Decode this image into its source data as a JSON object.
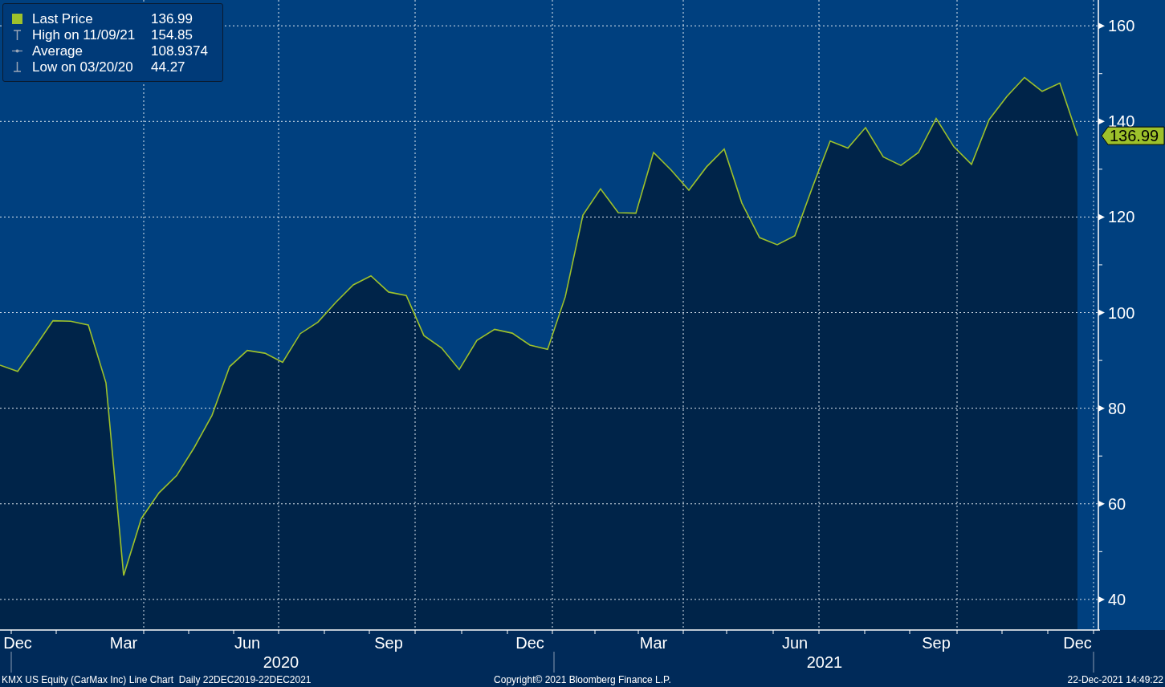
{
  "legend": [
    {
      "kind": "last",
      "value": "136.99"
    },
    {
      "kind": "high",
      "label": "High on 11/09/21",
      "value": "154.85"
    },
    {
      "kind": "average",
      "label": "Average",
      "value": "108.9374"
    },
    {
      "kind": "low",
      "label": "Low on 03/20/20",
      "value": "44.27"
    }
  ],
  "last_price_tag": "136.99",
  "chart_data": {
    "type": "line",
    "grid": true,
    "ylim": [
      33.6,
      165.4
    ],
    "yticks": [
      40,
      60,
      80,
      100,
      120,
      140,
      160
    ],
    "categories": [
      null,
      "Dec",
      null,
      null,
      null,
      null,
      null,
      "Mar",
      null,
      null,
      null,
      null,
      null,
      null,
      "Jun",
      null,
      null,
      null,
      null,
      null,
      null,
      null,
      "Sep",
      null,
      null,
      null,
      null,
      null,
      null,
      null,
      "Dec",
      null,
      null,
      null,
      null,
      null,
      null,
      "Mar",
      null,
      null,
      null,
      null,
      null,
      null,
      null,
      "Jun",
      null,
      null,
      null,
      null,
      null,
      null,
      null,
      "Sep",
      null,
      null,
      null,
      null,
      null,
      null,
      null,
      "Dec"
    ],
    "series": [
      {
        "name": "Last Price",
        "color": "#9dc12b",
        "values": [
          89,
          87.7,
          92.9,
          98.3,
          98.2,
          97.4,
          85.3,
          45,
          56.9,
          62.3,
          65.9,
          71.8,
          78.5,
          88.7,
          92.1,
          91.5,
          89.6,
          95.6,
          98,
          102.1,
          105.8,
          107.7,
          104.3,
          103.6,
          95.2,
          92.6,
          88.1,
          94.2,
          96.5,
          95.7,
          93.2,
          92.3,
          103.3,
          120.4,
          125.9,
          120.9,
          120.8,
          133.5,
          129.8,
          125.6,
          130.5,
          134.2,
          122.9,
          115.7,
          114.2,
          116.1,
          126.3,
          135.9,
          134.4,
          138.7,
          132.6,
          130.8,
          133.5,
          140.6,
          134.7,
          131,
          140.4,
          145.2,
          149.2,
          146.3,
          148,
          137
        ]
      }
    ]
  },
  "x_axis_years": [
    "2020",
    "2021"
  ],
  "footer": {
    "description": "KMX US Equity (CarMax Inc) Line Chart  Daily 22DEC2019-22DEC2021",
    "copyright": "Copyright© 2021 Bloomberg Finance L.P.",
    "timestamp": "22-Dec-2021 14:49:22"
  }
}
